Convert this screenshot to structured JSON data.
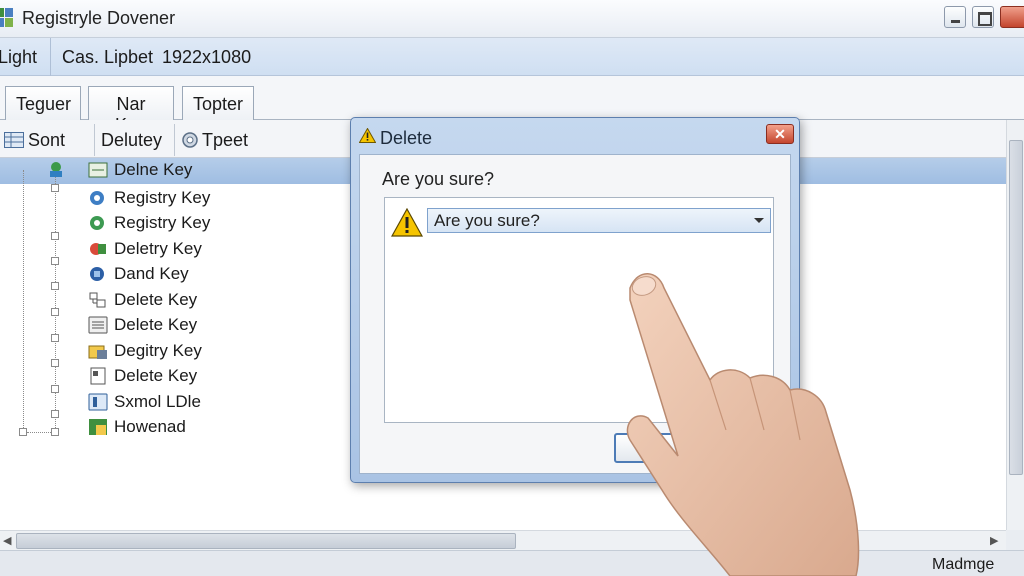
{
  "window": {
    "title": "Registryle Dovener",
    "controls": [
      "minimize",
      "maximize",
      "close"
    ]
  },
  "infobar": {
    "cells": [
      "Light",
      "Cas. Lipbet",
      "1922x1080"
    ]
  },
  "tabs": [
    {
      "label": "Teguer"
    },
    {
      "label": "Nar Kop"
    },
    {
      "label": "Topter"
    }
  ],
  "columns": [
    {
      "label": "Sont",
      "icon": "grid-icon"
    },
    {
      "label": "Delutey"
    },
    {
      "label": "Tpeet",
      "icon": "gear-icon"
    }
  ],
  "tree": {
    "items": [
      {
        "label": "Delne Key",
        "selected": true
      },
      {
        "label": "Registry Key"
      },
      {
        "label": "Registry Key"
      },
      {
        "label": "Deletry Key"
      },
      {
        "label": "Dand Key"
      },
      {
        "label": "Delete   Key"
      },
      {
        "label": "Delete Key"
      },
      {
        "label": "Degitry Key"
      },
      {
        "label": "Delete   Key"
      },
      {
        "label": "Sxmol LDle"
      },
      {
        "label": "Howenad"
      }
    ]
  },
  "dialog": {
    "title": "Delete",
    "question": "Are you sure?",
    "selected_value": "Are you sure?",
    "close_label": "✕"
  },
  "statusbar": {
    "text": "Madmge"
  },
  "colors": {
    "selection": "#a9c4e6",
    "dialog_frame": "#b7cde9",
    "close_red": "#c4462f",
    "warning_yellow": "#f5c400"
  }
}
